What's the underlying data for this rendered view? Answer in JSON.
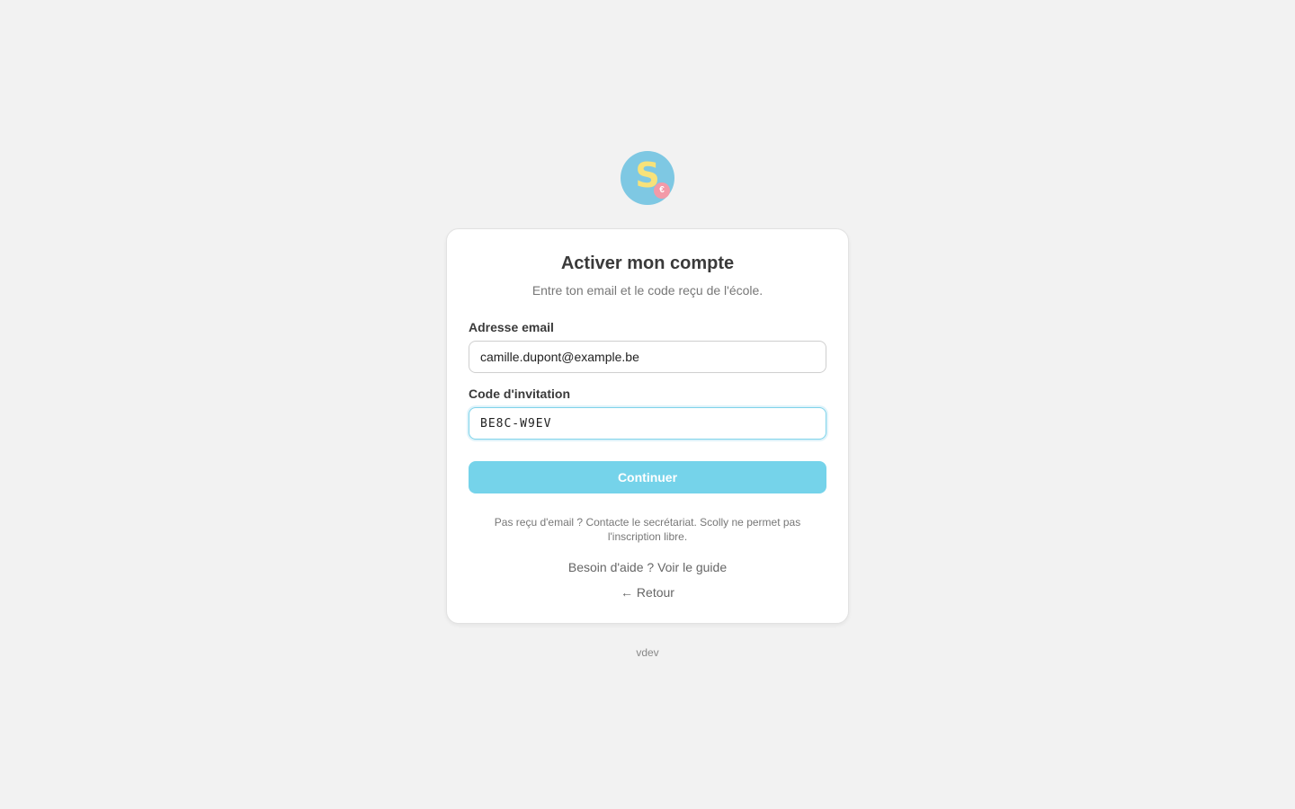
{
  "logo": {
    "letter": "S",
    "badge": "€",
    "colors": {
      "circle": "#7ec8e3",
      "letter": "#f7e27a",
      "badge": "#f39aa8"
    }
  },
  "card": {
    "title": "Activer mon compte",
    "subtitle": "Entre ton email et le code reçu de l'école.",
    "email": {
      "label": "Adresse email",
      "value": "camille.dupont@example.be"
    },
    "code": {
      "label": "Code d'invitation",
      "value": "BE8C-W9EV"
    },
    "submit_label": "Continuer",
    "note": "Pas reçu d'email ? Contacte le secrétariat. Scolly ne permet pas l'inscription libre.",
    "help_link": "Besoin d'aide ? Voir le guide",
    "back_link": "← Retour"
  },
  "footer": {
    "version": "vdev"
  },
  "colors": {
    "background": "#f2f2f2",
    "accent": "#75d3ea",
    "focus_border": "#7fd3ea"
  }
}
